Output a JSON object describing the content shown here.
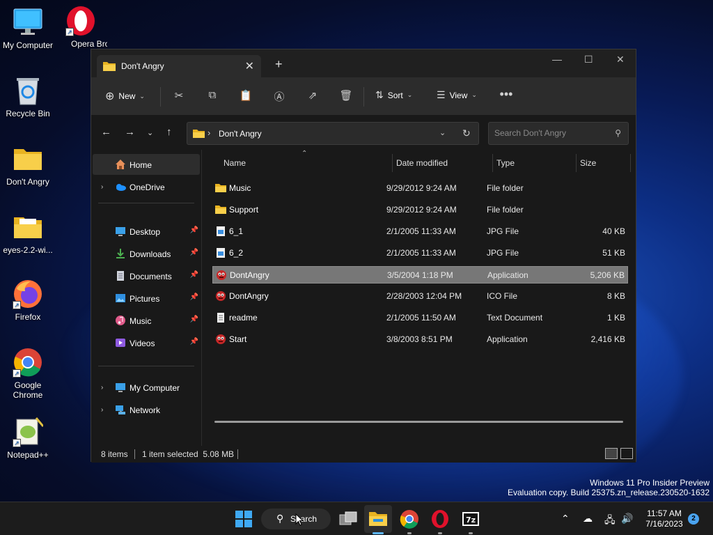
{
  "desktop": {
    "icons": [
      {
        "label": "My Computer"
      },
      {
        "label": "Opera Browser"
      },
      {
        "label": "Recycle Bin"
      },
      {
        "label": "Don't Angry"
      },
      {
        "label": "eyes-2.2-wi..."
      },
      {
        "label": "Firefox"
      },
      {
        "label": "Google Chrome"
      },
      {
        "label": "Notepad++"
      }
    ],
    "watermark_line1": "Windows 11 Pro Insider Preview",
    "watermark_line2": "Evaluation copy. Build 25375.zn_release.230520-1632"
  },
  "window": {
    "tab_title": "Don't Angry",
    "toolbar": {
      "new_label": "New",
      "sort_label": "Sort",
      "view_label": "View"
    },
    "address": {
      "crumb": "Don't Angry"
    },
    "search": {
      "placeholder": "Search Don't Angry"
    },
    "sidebar": {
      "home": "Home",
      "onedrive": "OneDrive",
      "quick": [
        "Desktop",
        "Downloads",
        "Documents",
        "Pictures",
        "Music",
        "Videos"
      ],
      "my_computer": "My Computer",
      "network": "Network"
    },
    "columns": {
      "name": "Name",
      "date": "Date modified",
      "type": "Type",
      "size": "Size"
    },
    "files": [
      {
        "name": "Music",
        "date": "9/29/2012 9:24 AM",
        "type": "File folder",
        "size": "",
        "icon": "folder"
      },
      {
        "name": "Support",
        "date": "9/29/2012 9:24 AM",
        "type": "File folder",
        "size": "",
        "icon": "folder"
      },
      {
        "name": "6_1",
        "date": "2/1/2005 11:33 AM",
        "type": "JPG File",
        "size": "40 KB",
        "icon": "image"
      },
      {
        "name": "6_2",
        "date": "2/1/2005 11:33 AM",
        "type": "JPG File",
        "size": "51 KB",
        "icon": "image"
      },
      {
        "name": "DontAngry",
        "date": "3/5/2004 1:18 PM",
        "type": "Application",
        "size": "5,206 KB",
        "icon": "app",
        "selected": true
      },
      {
        "name": "DontAngry",
        "date": "2/28/2003 12:04 PM",
        "type": "ICO File",
        "size": "8 KB",
        "icon": "app"
      },
      {
        "name": "readme",
        "date": "2/1/2005 11:50 AM",
        "type": "Text Document",
        "size": "1 KB",
        "icon": "text"
      },
      {
        "name": "Start",
        "date": "3/8/2003 8:51 PM",
        "type": "Application",
        "size": "2,416 KB",
        "icon": "app"
      }
    ],
    "status": {
      "items": "8 items",
      "selected": "1 item selected  5.08 MB"
    }
  },
  "taskbar": {
    "search_label": "Search",
    "time": "11:57 AM",
    "date": "7/16/2023",
    "notification_count": "2"
  }
}
